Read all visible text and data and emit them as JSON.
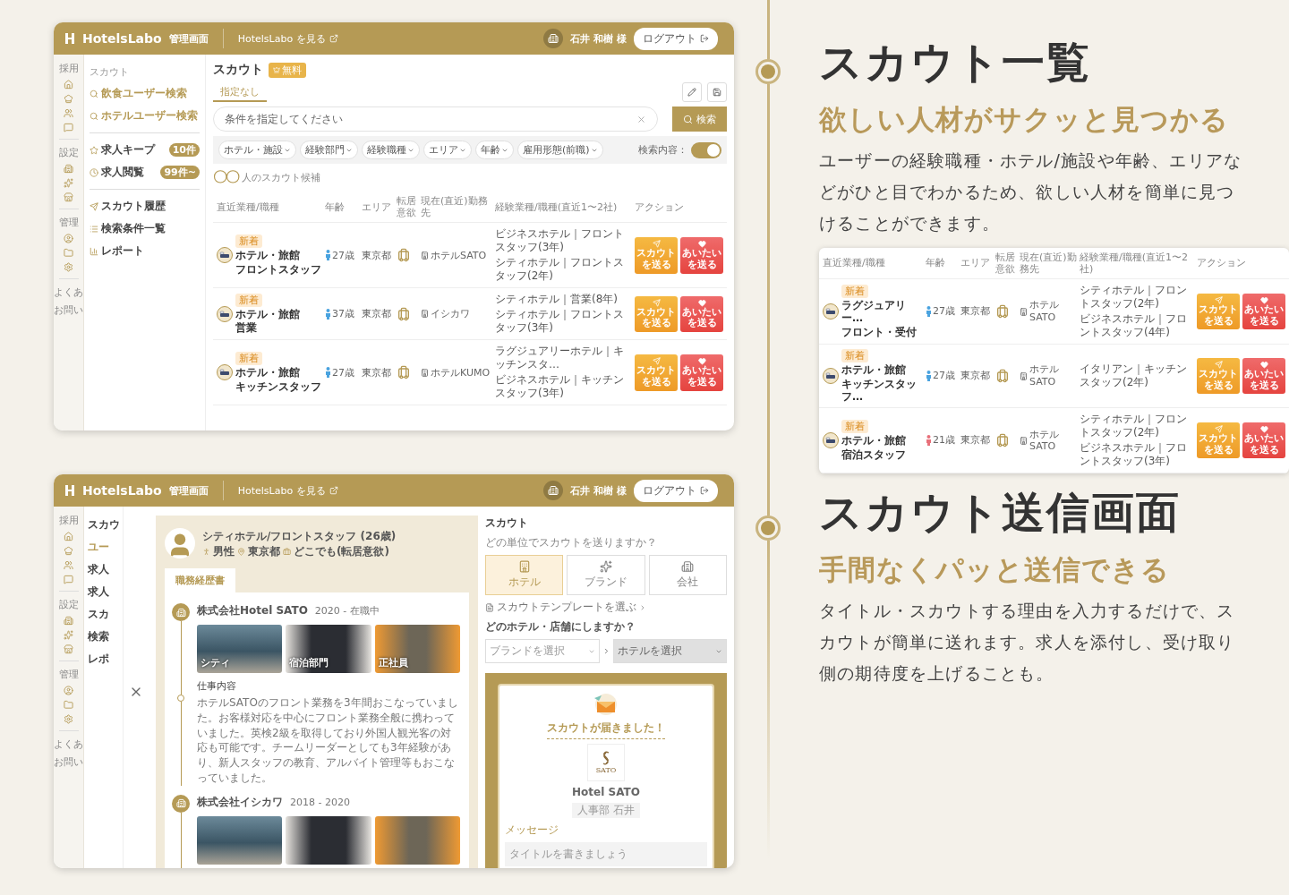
{
  "list_screen": {
    "header": {
      "brand": "HotelsLabo",
      "brand_sub": "管理画面",
      "site_link": "HotelsLabo を見る",
      "user": "石井 和樹 様",
      "logout": "ログアウト"
    },
    "rail": {
      "groups": [
        "採用",
        "設定",
        "管理"
      ],
      "footer": [
        "よくあ",
        "お問い"
      ]
    },
    "sidebar": {
      "heading": "スカウト",
      "groups": [
        [
          {
            "label": "飲食ユーザー検索"
          },
          {
            "label": "ホテルユーザー検索"
          }
        ],
        [
          {
            "label": "求人キープ",
            "badge": "10件"
          },
          {
            "label": "求人閲覧",
            "badge": "99件~"
          }
        ],
        [
          {
            "label": "スカウト履歴"
          },
          {
            "label": "検索条件一覧"
          },
          {
            "label": "レポート"
          }
        ]
      ]
    },
    "title": "スカウト",
    "title_badge": "無料",
    "tabs": [
      {
        "label": "指定なし",
        "selected": true
      }
    ],
    "search": {
      "placeholder": "条件を指定してください",
      "button": "検索"
    },
    "filters": [
      "ホテル・施設",
      "経験部門",
      "経験職種",
      "エリア",
      "年齢",
      "雇用形態(前職)"
    ],
    "toggle": {
      "label": "検索内容：",
      "on": true
    },
    "count": {
      "value": "〇〇",
      "label": "人のスカウト候補"
    },
    "table": {
      "columns": [
        "直近業種/職種",
        "年齢",
        "エリア",
        "転居意欲",
        "現在(直近)勤務先",
        "経験業種/職種(直近1〜2社)",
        "アクション"
      ],
      "rows": [
        {
          "tag": "新着",
          "industry": "ホテル・旅館",
          "job": "フロントスタッフ",
          "color": "#4aa3df",
          "age": "27歳",
          "area": "東京都",
          "employer": "ホテルSATO",
          "experience": [
            "ビジネスホテル｜フロントスタッフ(3年)",
            "シティホテル｜フロントスタッフ(2年)"
          ],
          "scout": {
            "label": "スカウト",
            "sub": "を送る"
          },
          "meet": {
            "label": "あいたい",
            "sub": "を送る"
          }
        },
        {
          "tag": "新着",
          "industry": "ホテル・旅館",
          "job": "営業",
          "color": "#4aa3df",
          "age": "37歳",
          "area": "東京都",
          "employer": "イシカワ",
          "experience": [
            "シティホテル｜営業(8年)",
            "シティホテル｜フロントスタッフ(3年)"
          ],
          "scout": {
            "label": "スカウト",
            "sub": "を送る"
          },
          "meet": {
            "label": "あいたい",
            "sub": "を送る"
          }
        },
        {
          "tag": "新着",
          "industry": "ホテル・旅館",
          "job": "キッチンスタッフ",
          "color": "#4aa3df",
          "age": "27歳",
          "area": "東京都",
          "employer": "ホテルKUMO",
          "experience": [
            "ラグジュアリーホテル｜キッチンスタ…",
            "ビジネスホテル｜キッチンスタッフ(3年)"
          ],
          "scout": {
            "label": "スカウト",
            "sub": "を送る"
          },
          "meet": {
            "label": "あいたい",
            "sub": "を送る"
          }
        }
      ]
    }
  },
  "detail_screen": {
    "header": {
      "brand": "HotelsLabo",
      "brand_sub": "管理画面",
      "site_link": "HotelsLabo を見る",
      "user": "石井 和樹 様",
      "logout": "ログアウト"
    },
    "rail": {
      "groups": [
        "採用",
        "設定",
        "管理"
      ],
      "footer": [
        "よくあ",
        "お問い"
      ]
    },
    "sidebar_partial": [
      "スカウ",
      "ユー",
      "求人",
      "求人",
      "スカ",
      "検索",
      "レポ"
    ],
    "profile": {
      "title": "シティホテル/フロントスタッフ (26歳)",
      "meta": [
        {
          "kind": "gender",
          "text": "男性"
        },
        {
          "kind": "location",
          "text": "東京都"
        },
        {
          "kind": "relocation",
          "text": "どこでも(転居意欲)"
        }
      ]
    },
    "tabs": [
      {
        "label": "職務経歴書",
        "selected": true
      }
    ],
    "careers": [
      {
        "company": "株式会社Hotel SATO",
        "period": "2020 - 在職中",
        "photos": [
          {
            "kind": "room",
            "caption": "シティ"
          },
          {
            "kind": "staff",
            "caption": "宿泊部門"
          },
          {
            "kind": "suit",
            "caption": "正社員"
          }
        ],
        "duties_label": "仕事内容",
        "duties": "ホテルSATOのフロント業務を3年間おこなっていました。お客様対応を中心にフロント業務全般に携わっていました。英検2級を取得しており外国人観光客の対応も可能です。チームリーダーとしても3年経験があり、新人スタッフの教育、アルバイト管理等もおこなっていました。"
      },
      {
        "company": "株式会社イシカワ",
        "period": "2018 - 2020",
        "photos": [
          {
            "kind": "room"
          },
          {
            "kind": "staff"
          },
          {
            "kind": "suit"
          }
        ]
      }
    ],
    "send": {
      "title": "スカウト",
      "question": "どの単位でスカウトを送りますか？",
      "units": [
        {
          "kind": "hotel",
          "label": "ホテル",
          "selected": true
        },
        {
          "kind": "brand",
          "label": "ブランド",
          "selected": false
        },
        {
          "kind": "company",
          "label": "会社",
          "selected": false
        }
      ],
      "template_link": "スカウトテンプレートを選ぶ",
      "target_question": "どのホテル・店舗にしますか？",
      "brand_select": {
        "placeholder": "ブランドを選択",
        "disabled": false
      },
      "hotel_select": {
        "placeholder": "ホテルを選択",
        "disabled": true
      },
      "preview": {
        "heading": "スカウトが届きました！",
        "logo": "SATO",
        "hotel": "Hotel SATO",
        "sender": "人事部 石井",
        "message_label": "メッセージ",
        "message_placeholder": "タイトルを書きましょう"
      }
    }
  },
  "sections": [
    {
      "title": "スカウト一覧",
      "subtitle": "欲しい人材がサクッと見つかる",
      "body": "ユーザーの経験職種・ホテル/施設や年齢、エリアなどがひと目でわかるため、欲しい人材を簡単に見つけることができます。",
      "table": {
        "columns": [
          "直近業種/職種",
          "年齢",
          "エリア",
          "転居意欲",
          "現在(直近)勤務先",
          "経験業種/職種(直近1〜2社)",
          "アクション"
        ],
        "rows": [
          {
            "tag": "新着",
            "industry": "ラグジュアリー…",
            "job": "フロント・受付",
            "color": "#4aa3df",
            "age": "27歳",
            "area": "東京都",
            "employer": "ホテルSATO",
            "experience": [
              "シティホテル｜フロントスタッフ(2年)",
              "ビジネスホテル｜フロントスタッフ(4年)"
            ],
            "scout": {
              "label": "スカウト",
              "sub": "を送る"
            },
            "meet": {
              "label": "あいたい",
              "sub": "を送る"
            }
          },
          {
            "tag": "新着",
            "industry": "ホテル・旅館",
            "job": "キッチンスタッフ…",
            "color": "#4aa3df",
            "age": "27歳",
            "area": "東京都",
            "employer": "ホテルSATO",
            "experience": [
              "イタリアン｜キッチンスタッフ(2年)"
            ],
            "scout": {
              "label": "スカウト",
              "sub": "を送る"
            },
            "meet": {
              "label": "あいたい",
              "sub": "を送る"
            }
          },
          {
            "tag": "新着",
            "industry": "ホテル・旅館",
            "job": "宿泊スタッフ",
            "color": "#e8707a",
            "age": "21歳",
            "area": "東京都",
            "employer": "ホテルSATO",
            "experience": [
              "シティホテル｜フロントスタッフ(2年)",
              "ビジネスホテル｜フロントスタッフ(3年)"
            ],
            "scout": {
              "label": "スカウト",
              "sub": "を送る"
            },
            "meet": {
              "label": "あいたい",
              "sub": "を送る"
            }
          }
        ]
      }
    },
    {
      "title": "スカウト送信画面",
      "subtitle": "手間なくパッと送信できる",
      "body": "タイトル・スカウトする理由を入力するだけで、スカウトが簡単に送れます。求人を添付し、受け取り側の期待度を上げることも。"
    }
  ]
}
